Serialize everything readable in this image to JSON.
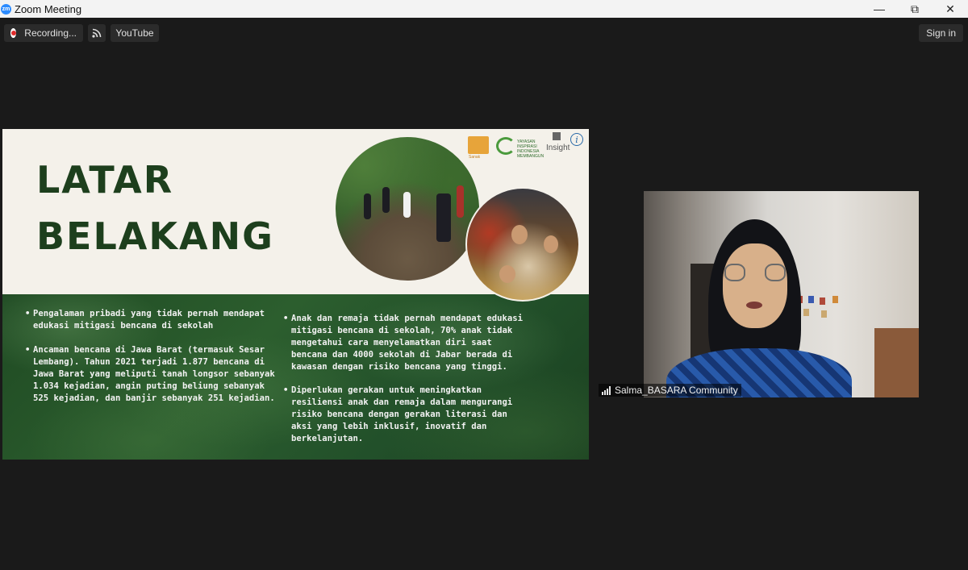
{
  "window": {
    "app_icon": "zm",
    "title": "Zoom Meeting",
    "controls": {
      "minimize": "—",
      "maximize": "⧉",
      "close": "✕"
    }
  },
  "toolbar": {
    "recording_label": "Recording...",
    "stream_label": "YouTube",
    "signin_label": "Sign in"
  },
  "slide": {
    "title_line1": "LATAR",
    "title_line2": "BELAKANG",
    "logos": {
      "logo1": "Sanak",
      "logo2": "YAYASAN INSPIRASI INDONESIA MEMBANGUN",
      "logo3": "Insight",
      "logo4": "i"
    },
    "bullets_left": [
      "Pengalaman pribadi yang tidak pernah mendapat edukasi mitigasi bencana di sekolah",
      "Ancaman bencana di Jawa Barat (termasuk Sesar Lembang). Tahun 2021 terjadi 1.877 bencana di Jawa Barat yang meliputi tanah longsor sebanyak 1.034 kejadian, angin puting beliung sebanyak 525 kejadian, dan banjir sebanyak 251 kejadian."
    ],
    "bullets_right": [
      "Anak dan remaja tidak pernah mendapat edukasi mitigasi bencana di sekolah, 70% anak tidak mengetahui cara menyelamatkan diri saat bencana dan 4000 sekolah di Jabar berada di kawasan dengan risiko bencana yang tinggi.",
      "Diperlukan gerakan untuk meningkatkan resiliensi anak dan remaja dalam mengurangi risiko bencana dengan gerakan literasi dan aksi yang lebih inklusif, inovatif dan berkelanjutan."
    ]
  },
  "participant": {
    "name": "Salma_BASARA Community"
  },
  "colors": {
    "background": "#1a1a1a",
    "title_green": "#1d3f1d",
    "slide_green": "#2c5e2e",
    "recording_red": "#e02b2b"
  }
}
